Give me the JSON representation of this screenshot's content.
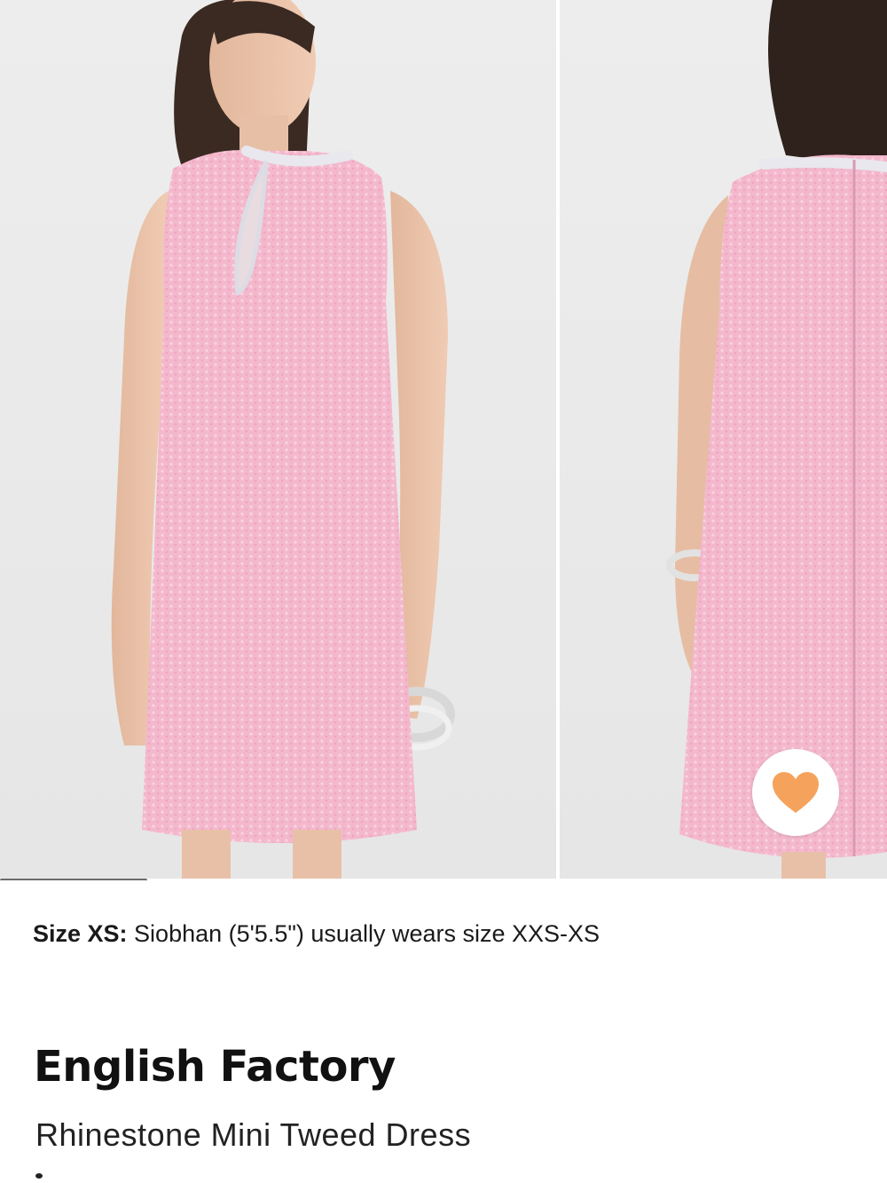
{
  "gallery": {
    "images": [
      {
        "name": "front-view",
        "alt": "Model wearing pink sequin shift dress, front view"
      },
      {
        "name": "back-view",
        "alt": "Pink sequin shift dress, back view with zipper"
      }
    ],
    "current_index": 0,
    "scroll_progress": 0.166
  },
  "favorite": {
    "icon": "heart-icon",
    "color": "#F5A35C"
  },
  "size_note": {
    "label": "Size XS:",
    "text": " Siobhan (5'5.5\") usually wears size XXS-XS"
  },
  "product": {
    "brand": "English Factory",
    "name": "Rhinestone Mini Tweed Dress"
  },
  "colors": {
    "dress_pink": "#F4B5CB",
    "accent_heart": "#F5A35C"
  }
}
